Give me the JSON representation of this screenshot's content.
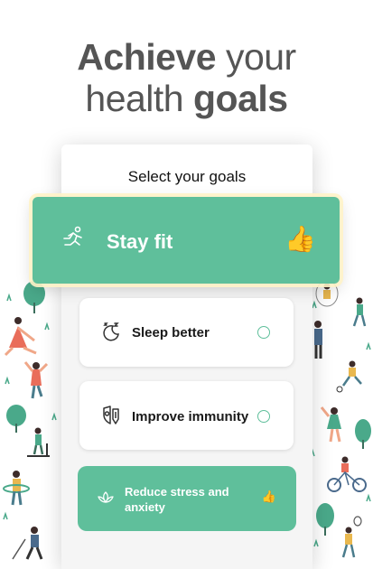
{
  "headline": {
    "word1": "Achieve",
    "word2": "your",
    "word3": "health",
    "word4": "goals"
  },
  "screen_title": "Select your goals",
  "goals": [
    {
      "label": "Stay fit",
      "icon": "runner-icon",
      "selected": true,
      "mark": "👍"
    },
    {
      "label": "Sleep better",
      "icon": "moon-sleep-icon",
      "selected": false
    },
    {
      "label": "Improve immunity",
      "icon": "shield-virus-icon",
      "selected": false
    },
    {
      "label": "Reduce stress and anxiety",
      "icon": "lotus-icon",
      "selected": true,
      "mark": "👍"
    }
  ],
  "colors": {
    "accent": "#5fbf9b",
    "headline": "#555555",
    "illustration": "#4aa98a",
    "skin": "#f0a788"
  }
}
